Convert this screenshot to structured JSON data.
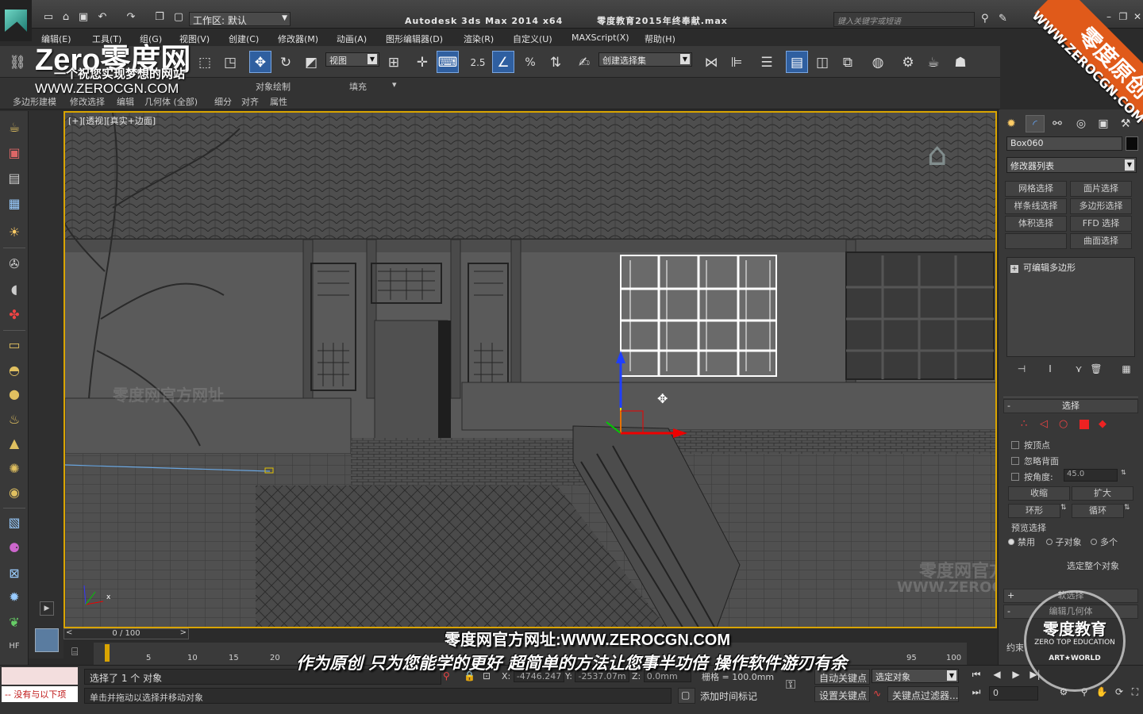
{
  "titlebar": {
    "workspace_label": "工作区: 默认",
    "app_title": "Autodesk 3ds Max  2014 x64",
    "file_title": "零度教育2015年终奉献.max",
    "help_search_placeholder": "键入关键字或短语"
  },
  "menu": [
    "编辑(E)",
    "工具(T)",
    "组(G)",
    "视图(V)",
    "创建(C)",
    "修改器(M)",
    "动画(A)",
    "图形编辑器(D)",
    "渲染(R)",
    "自定义(U)",
    "MAXScript(X)",
    "帮助(H)"
  ],
  "toolbar": {
    "ref_coord": "视图",
    "snap_label": "2.5",
    "named_selection": "创建选择集"
  },
  "ribbon": {
    "object_paint": "对象绘制",
    "fill": "填充",
    "tabs": [
      "多边形建模",
      "修改选择",
      "编辑",
      "几何体 (全部)",
      "细分",
      "对齐",
      "属性"
    ]
  },
  "viewport": {
    "label": "[+][透视][真实+边面]",
    "axis_x": "x"
  },
  "command_panel": {
    "object_name": "Box060",
    "modifier_list": "修改器列表",
    "modifier_buttons": [
      "网格选择",
      "面片选择",
      "样条线选择",
      "多边形选择",
      "体积选择",
      "FFD 选择",
      "",
      "曲面选择"
    ],
    "stack_item": "可编辑多边形",
    "selection_rollout": "选择",
    "by_vertex": "按顶点",
    "ignore_backfacing": "忽略背面",
    "by_angle": "按角度:",
    "angle_value": "45.0",
    "shrink": "收缩",
    "grow": "扩大",
    "ring": "环形",
    "loop": "循环",
    "preview_selection": "预览选择",
    "disabled": "禁用",
    "subobject": "子对象",
    "multi": "多个",
    "select_whole": "选定整个对象",
    "soft_selection": "软选择",
    "edit_geometry": "编辑几何体",
    "constraint": "约束"
  },
  "timeline": {
    "slider": "0 / 100",
    "ticks": [
      "0",
      "5",
      "10",
      "15",
      "20",
      "95",
      "100"
    ]
  },
  "status": {
    "maxscript_error": "-- 没有与以下项",
    "selected": "选择了 1 个 对象",
    "prompt": "单击并拖动以选择并移动对象",
    "x_label": "X:",
    "x_value": "-4746.247",
    "y_label": "Y:",
    "y_value": "-2537.07m",
    "z_label": "Z:",
    "z_value": "0.0mm",
    "grid": "栅格 = 100.0mm",
    "auto_key": "自动关键点",
    "set_key": "设置关键点",
    "selected_obj": "选定对象",
    "key_filters": "关键点过滤器...",
    "add_time_tag": "添加时间标记",
    "frame_value": "0"
  },
  "overlays": {
    "brand_main": "Zero零度网",
    "brand_sub": "一个祝您实现梦想的网站",
    "brand_url": "WWW.ZEROCGN.COM",
    "corner_band": "零度原创",
    "corner_url": "WWW.ZEROCGN.COM",
    "subtitle_1": "零度网官方网址:WWW.ZEROCGN.COM",
    "subtitle_2": "作为原创 只为您能学的更好 超简单的方法让您事半功倍 操作软件游刃有余",
    "seal_title": "零度教育",
    "seal_en": "ZERO TOP EDUCATION",
    "seal_brand": "ART★WORLD",
    "watermark_cn": "零度网官方网址",
    "watermark_url": "WWW.ZEROCGN.COM"
  },
  "colors": {
    "accent_active": "#2f5fa0",
    "viewport_border": "#d9a400",
    "brand_orange": "#e05a1a"
  }
}
